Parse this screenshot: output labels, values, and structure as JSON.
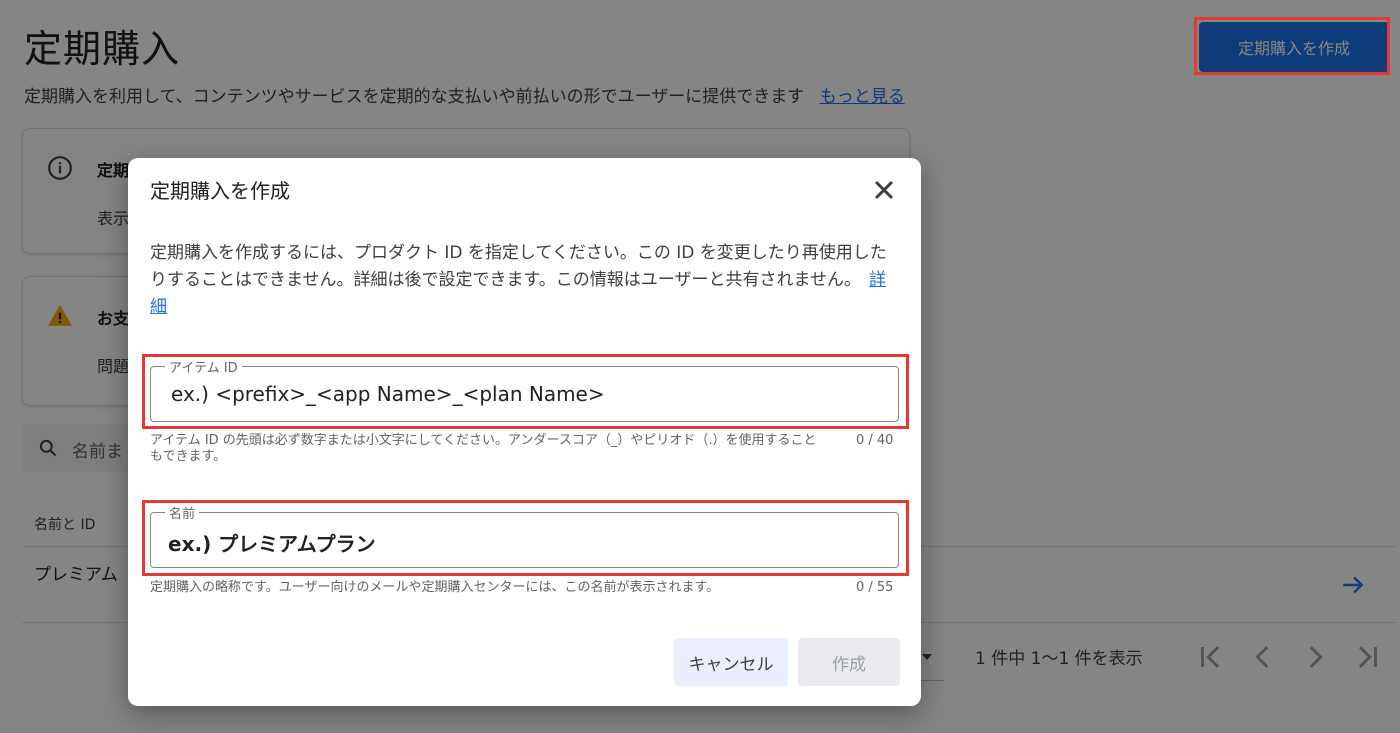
{
  "page": {
    "title": "定期購入",
    "create_button_label": "定期購入を作成",
    "subtitle": "定期購入を利用して、コンテンツやサービスを定期的な支払いや前払いの形でユーザーに提供できます",
    "learn_more_link": "もっと見る"
  },
  "cards": {
    "info": {
      "heading": "定期",
      "body": "表示"
    },
    "warning": {
      "heading": "お支",
      "body": "問題"
    }
  },
  "search": {
    "placeholder": "名前ま"
  },
  "table": {
    "column_header": "名前と ID",
    "rows": [
      {
        "name": "プレミアム"
      }
    ]
  },
  "pagination": {
    "summary": "1 件中 1〜1 件を表示"
  },
  "dialog": {
    "title": "定期購入を作成",
    "description": "定期購入を作成するには、プロダクト ID を指定してください。この ID を変更したり再使用したりすることはできません。詳細は後で設定できます。この情報はユーザーと共有されません。",
    "details_link": "詳細",
    "item_id_field": {
      "label": "アイテム ID",
      "placeholder": "ex.) <prefix>_<app Name>_<plan Name>",
      "helper": "アイテム ID の先頭は必ず数字または小文字にしてください。アンダースコア（_）やピリオド（.）を使用することもできます。",
      "counter": "0 / 40"
    },
    "name_field": {
      "label": "名前",
      "placeholder": "ex.) プレミアムプラン",
      "helper": "定期購入の略称です。ユーザー向けのメールや定期購入センターには、この名前が表示されます。",
      "counter": "0 / 55"
    },
    "cancel_label": "キャンセル",
    "create_label": "作成"
  },
  "colors": {
    "accent": "#1a73e8",
    "highlight": "#e53935",
    "scrim": "rgba(0,0,0,0.48)"
  },
  "icons": [
    "info-icon",
    "warning-icon",
    "search-icon",
    "arrow-right-icon",
    "first-page-icon",
    "previous-page-icon",
    "next-page-icon",
    "last-page-icon",
    "close-icon",
    "dropdown-caret-icon"
  ]
}
